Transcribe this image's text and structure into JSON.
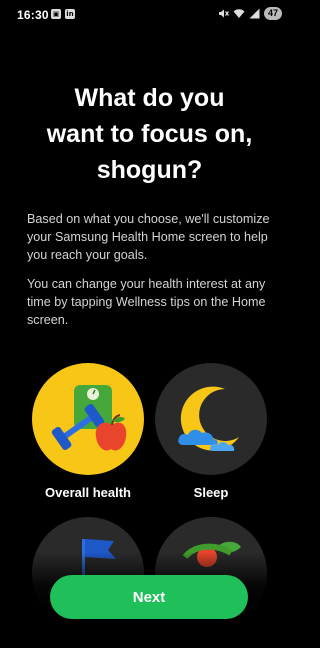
{
  "status_bar": {
    "time": "16:30",
    "left_icons": [
      "photo-icon",
      "linkedin-icon"
    ],
    "right_icons": [
      "mute-icon",
      "wifi-icon",
      "signal-icon"
    ],
    "battery": "47"
  },
  "header": {
    "title": "What do you\nwant to focus on,\nshogun?"
  },
  "body": {
    "paragraph_1": "Based on what you choose, we'll customize your Samsung Health Home screen to help you reach your goals.",
    "paragraph_2": "You can change your health interest at any time by tapping Wellness tips on the Home screen."
  },
  "options": [
    {
      "label": "Overall health",
      "icon": "dumbbell-apple-scale-icon",
      "selected": true
    },
    {
      "label": "Sleep",
      "icon": "moon-cloud-icon",
      "selected": false
    }
  ],
  "footer": {
    "next_label": "Next"
  },
  "colors": {
    "background": "#000000",
    "accent_green": "#1fbf59",
    "selected_circle": "#f7c617",
    "unselected_circle": "#2a2a2a"
  }
}
